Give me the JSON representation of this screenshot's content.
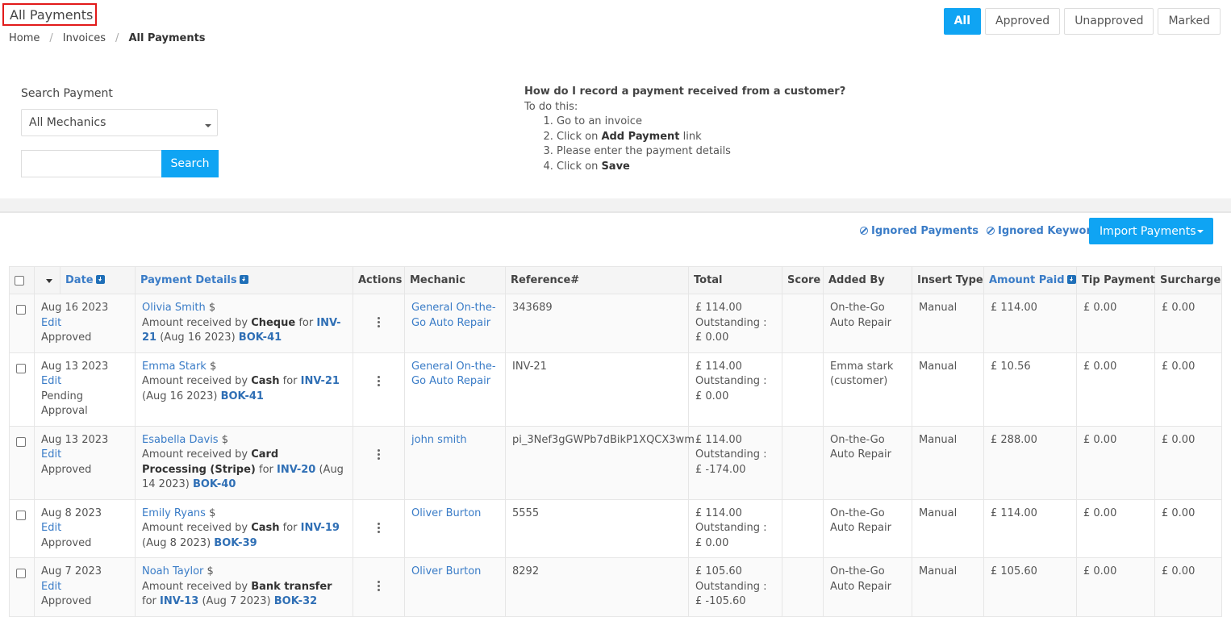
{
  "header": {
    "title": "All Payments",
    "breadcrumb": [
      "Home",
      "Invoices",
      "All Payments"
    ]
  },
  "filters": [
    "All",
    "Approved",
    "Unapproved",
    "Marked"
  ],
  "search": {
    "label": "Search Payment",
    "mechanic_select": "All Mechanics",
    "input_value": "",
    "button": "Search"
  },
  "help": {
    "question": "How do I record a payment received from a customer?",
    "intro": "To do this:",
    "step1": "Go to an invoice",
    "step2_pre": "Click on ",
    "step2_bold": "Add Payment",
    "step2_post": " link",
    "step3": "Please enter the payment details",
    "step4_pre": "Click on ",
    "step4_bold": "Save"
  },
  "toolbar": {
    "ignored_payments": "Ignored Payments",
    "ignored_keywords": "Ignored Keywords",
    "import_payments": "Import Payments"
  },
  "table": {
    "headers": {
      "date": "Date",
      "payment_details": "Payment Details",
      "actions": "Actions",
      "mechanic": "Mechanic",
      "reference": "Reference#",
      "total": "Total",
      "score": "Score",
      "added_by": "Added By",
      "insert_type": "Insert Type",
      "amount_paid": "Amount Paid",
      "tip_payment": "Tip Payment",
      "surcharge": "Surcharge"
    },
    "rows": [
      {
        "date": "Aug 16 2023",
        "edit": "Edit",
        "status": "Approved",
        "customer": "Olivia Smith",
        "dollar": "$",
        "d_pre": "Amount received by ",
        "method": "Cheque",
        "d_for": " for ",
        "invoice": "INV-21",
        "d_date": " (Aug 16 2023) ",
        "booking": "BOK-41",
        "mechanic": "General On-the-Go Auto Repair",
        "reference": "343689",
        "total": "£ 114.00",
        "outstanding": "Outstanding : £ 0.00",
        "score": "",
        "added_by": "On-the-Go Auto Repair",
        "insert_type": "Manual",
        "amount_paid": "£ 114.00",
        "tip": "£ 0.00",
        "surcharge": "£ 0.00"
      },
      {
        "date": "Aug 13 2023",
        "edit": "Edit",
        "status": "Pending Approval",
        "customer": "Emma Stark",
        "dollar": "$",
        "d_pre": "Amount received by ",
        "method": "Cash",
        "d_for": " for ",
        "invoice": "INV-21",
        "d_date": " (Aug 16 2023) ",
        "booking": "BOK-41",
        "mechanic": "General On-the-Go Auto Repair",
        "reference": "INV-21",
        "total": "£ 114.00",
        "outstanding": "Outstanding : £ 0.00",
        "score": "",
        "added_by": "Emma stark (customer)",
        "insert_type": "Manual",
        "amount_paid": "£ 10.56",
        "tip": "£ 0.00",
        "surcharge": "£ 0.00"
      },
      {
        "date": "Aug 13 2023",
        "edit": "Edit",
        "status": "Approved",
        "customer": "Esabella Davis",
        "dollar": "$",
        "d_pre": "Amount received by ",
        "method": "Card Processing (Stripe)",
        "d_for": " for ",
        "invoice": "INV-20",
        "d_date": " (Aug 14 2023) ",
        "booking": "BOK-40",
        "mechanic": "john smith",
        "reference": "pi_3Nef3gGWPb7dBikP1XQCX3wm",
        "total": "£ 114.00",
        "outstanding": "Outstanding : £ -174.00",
        "score": "",
        "added_by": "On-the-Go Auto Repair",
        "insert_type": "Manual",
        "amount_paid": "£ 288.00",
        "tip": "£ 0.00",
        "surcharge": "£ 0.00"
      },
      {
        "date": "Aug 8 2023",
        "edit": "Edit",
        "status": "Approved",
        "customer": "Emily Ryans",
        "dollar": "$",
        "d_pre": "Amount received by ",
        "method": "Cash",
        "d_for": " for ",
        "invoice": "INV-19",
        "d_date": " (Aug 8 2023) ",
        "booking": "BOK-39",
        "mechanic": "Oliver Burton",
        "reference": "5555",
        "total": "£ 114.00",
        "outstanding": "Outstanding : £ 0.00",
        "score": "",
        "added_by": "On-the-Go Auto Repair",
        "insert_type": "Manual",
        "amount_paid": "£ 114.00",
        "tip": "£ 0.00",
        "surcharge": "£ 0.00"
      },
      {
        "date": "Aug 7 2023",
        "edit": "Edit",
        "status": "Approved",
        "customer": "Noah Taylor",
        "dollar": "$",
        "d_pre": "Amount received by ",
        "method": "Bank transfer",
        "d_for": " for ",
        "invoice": "INV-13",
        "d_date": " (Aug 7 2023) ",
        "booking": "BOK-32",
        "mechanic": "Oliver Burton",
        "reference": "8292",
        "total": "£ 105.60",
        "outstanding": "Outstanding : £ -105.60",
        "score": "",
        "added_by": "On-the-Go Auto Repair",
        "insert_type": "Manual",
        "amount_paid": "£ 105.60",
        "tip": "£ 0.00",
        "surcharge": "£ 0.00"
      }
    ]
  }
}
